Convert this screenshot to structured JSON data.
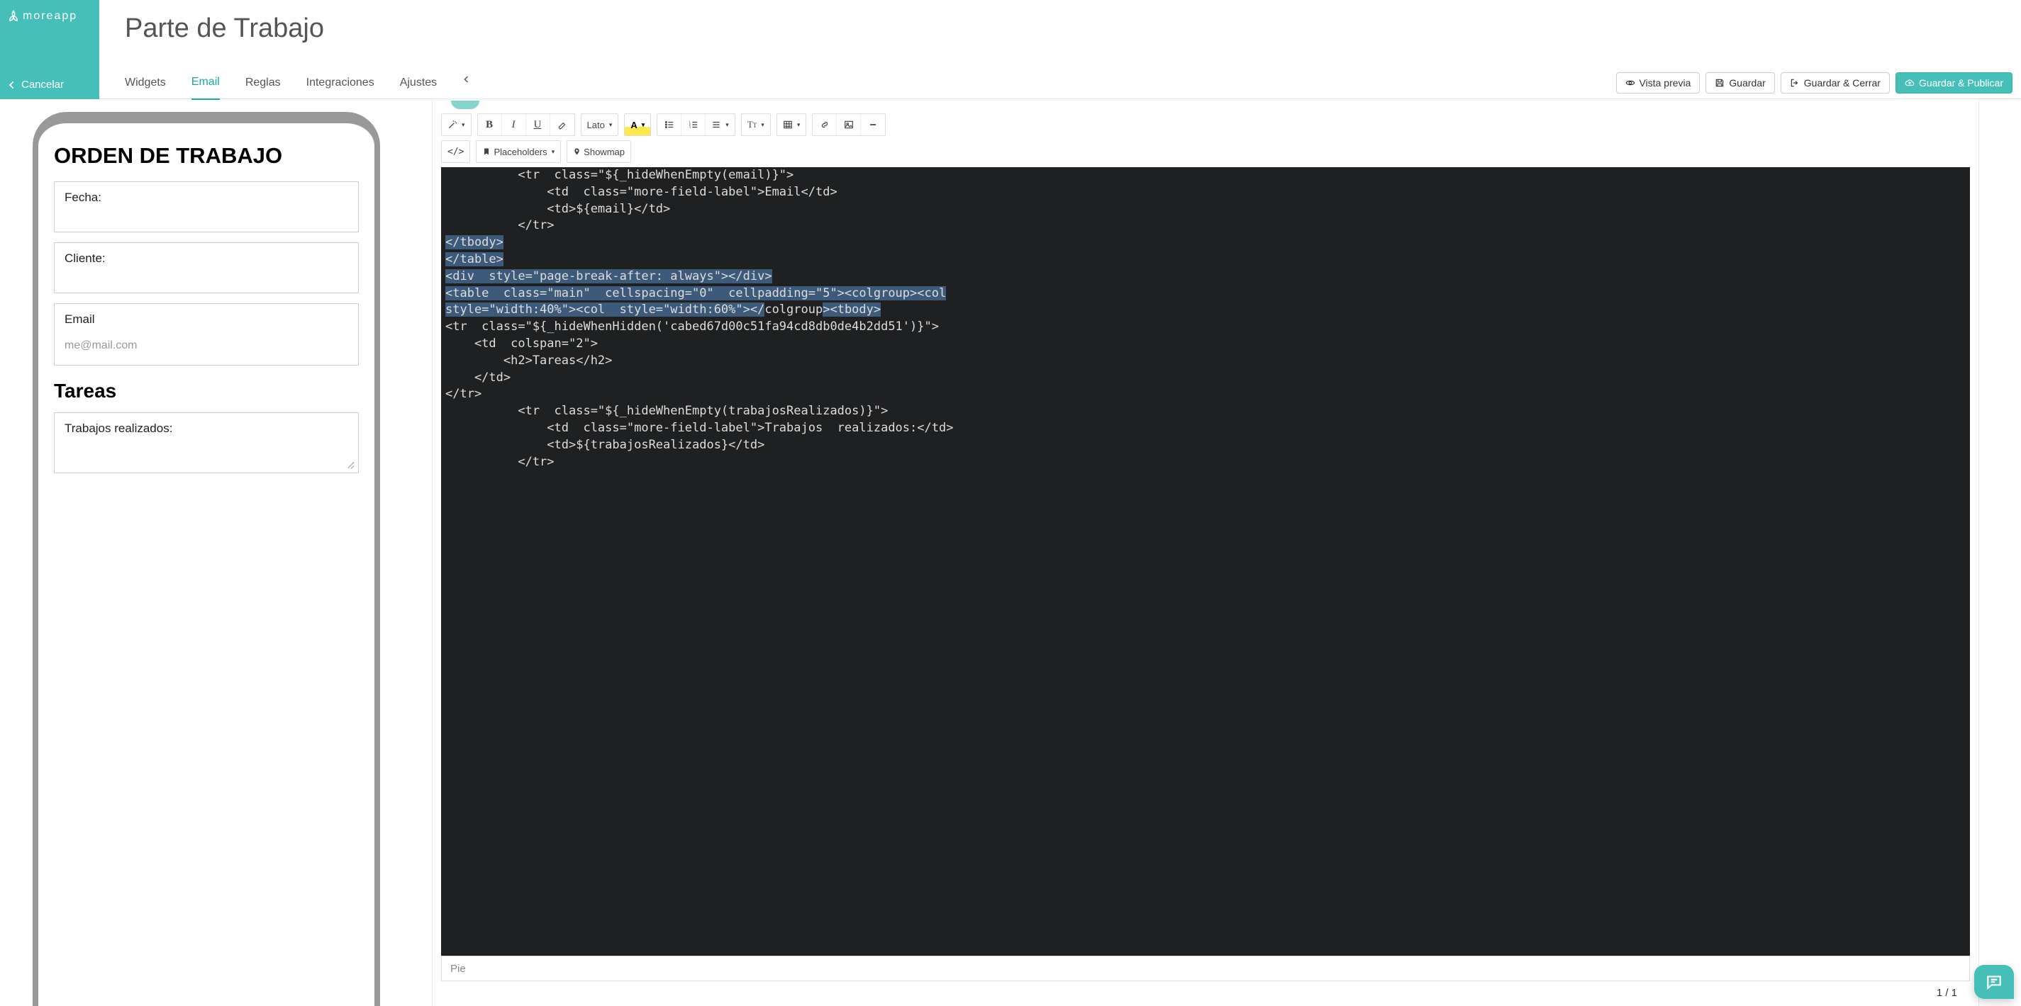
{
  "brand": {
    "name": "moreapp"
  },
  "cancel_label": "Cancelar",
  "page_title": "Parte de Trabajo",
  "tabs": {
    "widgets": "Widgets",
    "email": "Email",
    "rules": "Reglas",
    "integrations": "Integraciones",
    "settings": "Ajustes"
  },
  "actions": {
    "preview": "Vista previa",
    "save": "Guardar",
    "save_close": "Guardar & Cerrar",
    "save_publish": "Guardar & Publicar"
  },
  "preview_form": {
    "heading": "ORDEN DE TRABAJO",
    "field_fecha": "Fecha:",
    "field_cliente": "Cliente:",
    "field_email_label": "Email",
    "field_email_placeholder": "me@mail.com",
    "section_tareas": "Tareas",
    "field_trabajos": "Trabajos realizados:"
  },
  "toolbar": {
    "font_family": "Lato",
    "font_letter": "A",
    "placeholders": "Placeholders",
    "showmap": "Showmap",
    "code_tag": "</>"
  },
  "editor_code": {
    "l1": "          <tr  class=\"${_hideWhenEmpty(email)}\">",
    "l2": "              <td  class=\"more-field-label\">Email</td>",
    "l3": "              <td>${email}</td>",
    "l4": "          </tr>",
    "l5": "</tbody>",
    "l6": "",
    "l7": "</table>",
    "l8": "",
    "l9": "<div  style=\"page-break-after: always\"></div>",
    "l10": "",
    "l11a": "<table  class=\"main\"  cellspacing=\"0\"  cellpadding=\"5\"><colgroup><col",
    "l11b": "style=\"width:40%\"><col  style=\"width:60%\"></",
    "l11c": "colgroup",
    "l11d": "><tbody>",
    "l12": "",
    "l13": "<tr  class=\"${_hideWhenHidden('cabed67d00c51fa94cd8db0de4b2dd51')}\">",
    "l14": "    <td  colspan=\"2\">",
    "l15": "        <h2>Tareas</h2>",
    "l16": "    </td>",
    "l17": "</tr>",
    "l18": "",
    "l19": "          <tr  class=\"${_hideWhenEmpty(trabajosRealizados)}\">",
    "l20": "              <td  class=\"more-field-label\">Trabajos  realizados:</td>",
    "l21": "              <td>${trabajosRealizados}</td>",
    "l22": "          </tr>"
  },
  "pie_label": "Pie",
  "pagination": "1 / 1"
}
